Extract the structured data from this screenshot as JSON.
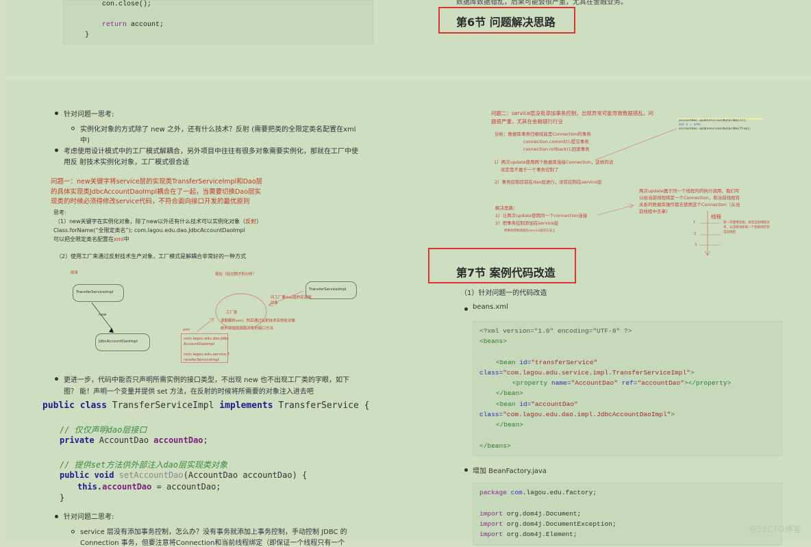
{
  "top_left_code": {
    "lines": [
      "con.close();",
      "return account;",
      "}"
    ]
  },
  "top_right": {
    "partial_text": "数据库数据错乱，后果可能会很严重，尤其在金融业务。",
    "section6_heading": "第6节 问题解决思路"
  },
  "left_column": {
    "bullet1": "针对问题一思考:",
    "sub1_line1": "实例化对象的方式除了 new 之外，还有什么技术？反射 (需要把类的全限定类名配置在xml",
    "sub1_line2": "中)",
    "bullet2_line1": "考虑使用设计模式中的工厂模式解耦合，另外项目中往往有很多对象需要实例化，那就在工厂中使",
    "bullet2_line2": "用反 射技术实例化对象，工厂模式很合适",
    "problem1_line1": "问题一：new关键字将service层的实现类TransferServiceImpl和Dao层",
    "problem1_line2": "的具体实现类JdbcAccountDaoImpl耦合在了一起，当需要切换Dao层实",
    "problem1_line3": "现类的时候必须得修改service代码，不符合面向接口开发的最优原则",
    "think_label": "思考:",
    "think1_pre": "（1）new关键字在实例化对象，除了new以外还有什么技术可以实例化对象（",
    "think1_red": "反射",
    "think1_post": "）",
    "think_classforname": "Class.forName(“全限定类名”);    com.lagou.edu.dao.JdbcAccountDaoImpl",
    "think_xml_pre": "可以把全限定类名配置在",
    "think_xml_red": "xml",
    "think_xml_post": "中",
    "think2": "（2）使用工厂来通过反射技术生产对象，工厂模式是解耦合非常好的一种方式",
    "diagram": {
      "before_label": "原来",
      "now_label": "现在（经过刚才的分析）",
      "box_transfer_left": "TransferServiceImpl",
      "arrow_new": "new",
      "box_jdbc": "JdbcAccountDaoImpl",
      "box_transfer_right": "TransferServiceImpl",
      "ask_factory_line1": "问工厂要dao层的实现类",
      "ask_factory_line2": "对象",
      "factory_label": "工厂类",
      "factory_desc1": "读取解析xml，然后通过反射技术实例化对象",
      "factory_desc2": "给外部提供获取对象的接口方法",
      "xml_label": "xml",
      "xml_box_lines": [
        "com.lagou.edu.dao.Jdbc",
        "AccountDaoImpl",
        "",
        "com.lagou.edu.service.T",
        "ransferServiceImpl"
      ]
    },
    "bullet3_line1": "更进一步，代码中能否只声明所需实例的接口类型，不出现 new 也不出现工厂类的字眼，如下",
    "bullet3_line2": "图？ 能！声明一个变量并提供 set 方法，在反射的时候将所需要的对象注入进去吧",
    "java_code": {
      "l1_kw1": "public class",
      "l1_name": " TransferServiceImpl ",
      "l1_kw2": "implements",
      "l1_rest": " TransferService {",
      "c1": "// 仅仅声明dao层接口",
      "l2_kw": "private",
      "l2_type": " AccountDao ",
      "l2_field": "accountDao",
      "l2_end": ";",
      "c2": "// 提供set方法供外部注入dao层实现类对象",
      "l3_kw": "public void",
      "l3_method": " setAccountDao",
      "l3_rest": "(AccountDao accountDao) {",
      "l4_kw": "this.",
      "l4_field": "accountDao",
      "l4_rest": " = accountDao;",
      "l5": "}"
    },
    "bullet4": "针对问题二思考:",
    "sub4_line1": "service 层没有添加事务控制，怎么办？没有事务就添加上事务控制，手动控制 JDBC 的",
    "sub4_line2": "Connection 事务，但要注意将Connection和当前线程绑定（即保证一个线程只有一个"
  },
  "right_column": {
    "problem2_line1": "问题二：service层没有添加事务控制，出现异常可能导致数据错乱，问",
    "problem2_line2": "题很严重，尤其在金融银行行业",
    "analysis_line1": "分析：数据库事务归根结底是Connection的事务",
    "analysis_line2": "connection.commit();提交事务",
    "analysis_line3": "connection.rollback();回滚事务",
    "point1_line1": "1）两次update使用两个数据库连接Connection，这样的话",
    "point1_line2": "肯定是不属于一个事务控制了",
    "point2": "2）事务控制目前在dao层进行，没有控制在service层",
    "snippet": [
      "accountDao.updateAccountByCardNo(to);",
      "int c = 1/0;",
      "accountDao.updateAccountByCardNo(from);"
    ],
    "solution_label": "解决思路：",
    "solution1": "1）让两次update使用同一个connection连接",
    "solution2": "2）把事务控制添加在service层",
    "solution_note": "把事务控制添加在service层的方法上",
    "thread_note_lines": [
      "两次update属于同一个线程内的执行调用，我们可",
      "以给当前线程绑定一个Connection，和当前线程有",
      "关系的数据库操作都去使用这个Connection（从当",
      "前线程中去拿）"
    ],
    "thread_label": "线程",
    "thread_ticks": [
      "1",
      "2",
      "3"
    ],
    "thread_tick_note_lines": [
      "第一次使用连接，发现当前线程没",
      "有，从连接池获取一个连接绑定到",
      "当前线程"
    ],
    "section7_heading": "第7节 案例代码改造",
    "sub_heading": "（1）针对问题一的代码改造",
    "beans_bullet": "beans.xml",
    "beanfactory_bullet": "增加 BeanFactory.java",
    "java_package_kw": "package",
    "java_package_pkg": " com",
    "java_package_rest": ".lagou.edu.factory;",
    "java_imports": [
      "org.dom4j.Document;",
      "org.dom4j.DocumentException;",
      "org.dom4j.Element;"
    ],
    "import_kw": "import"
  },
  "xml_code": {
    "pi": "<?xml version=\"1.0\" encoding=\"UTF-8\" ?>",
    "beans_open": "<beans>",
    "bean1_open": "<bean ",
    "id_attr": "id=",
    "bean1_id": "\"transferService\"",
    "class_attr": "class=",
    "bean1_class": "\"com.lagou.edu.service.impl.TransferServiceImpl\"",
    "gt": ">",
    "prop_open": "<property ",
    "name_attr": "name=",
    "prop_name": "\"AccountDao\"",
    "ref_attr": " ref=",
    "prop_ref": "\"accountDao\"",
    "prop_close": "></property>",
    "bean_close": "</bean>",
    "bean2_id": "\"accountDao\"",
    "bean2_class": "\"com.lagou.edu.dao.impl.JdbcAccountDaoImpl\"",
    "beans_close": "</beans>"
  },
  "watermark": "@51CTO博客",
  "colors": {
    "background": "#d3e2c5",
    "page": "#cedec1",
    "heading_border": "#e03131",
    "annotation_red": "#c0392b"
  }
}
